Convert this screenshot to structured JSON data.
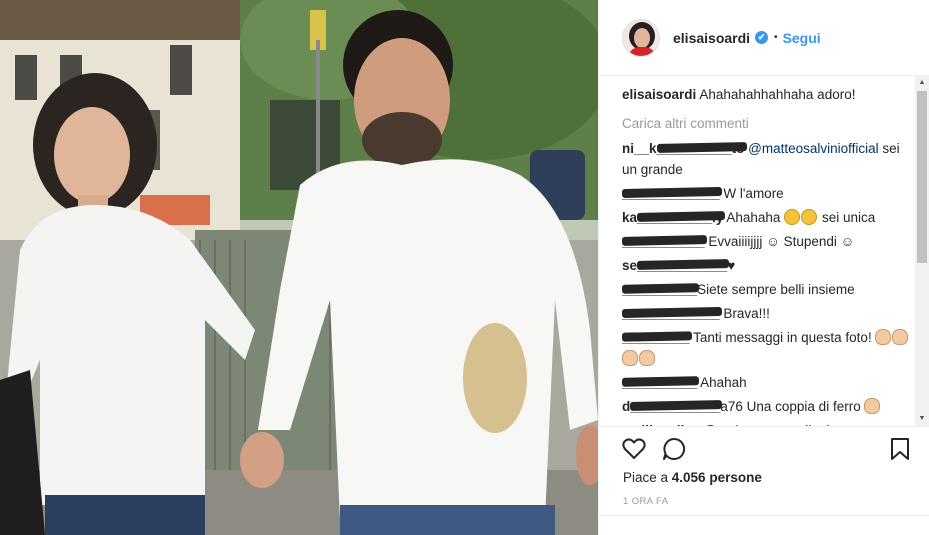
{
  "post": {
    "author": "elisaisoardi",
    "verified_mark": "✔",
    "separator": "•",
    "follow_label": "Segui"
  },
  "caption": {
    "author": "elisaisoardi",
    "text": "Ahahahahhahhaha adoro!"
  },
  "load_more_label": "Carica altri commenti",
  "comments": [
    {
      "user_visible": "ni__k",
      "user_hidden": "__________to",
      "mention": "@matteosalviniofficial",
      "text": " sei un grande"
    },
    {
      "user_visible": "",
      "user_hidden": "_____________",
      "mention": "",
      "text": " W l'amore"
    },
    {
      "user_visible": "ka",
      "user_hidden": "__________ly",
      "mention": "",
      "text": " Ahahaha ",
      "emojis": [
        "grinning-sweat-face",
        "grinning-sweat-face"
      ],
      "text_after": " sei unica"
    },
    {
      "user_visible": "",
      "user_hidden": "___________",
      "mention": "",
      "text": " Evvaiiiijjjj ☺ Stupendi ☺"
    },
    {
      "user_visible": "se",
      "user_hidden": "____________",
      "mention": "",
      "text": "♥"
    },
    {
      "user_visible": "",
      "user_hidden": "__________",
      "mention": "",
      "text": "Siete sempre belli insieme"
    },
    {
      "user_visible": "",
      "user_hidden": "_____________",
      "mention": "",
      "text": " Brava!!!"
    },
    {
      "user_visible": "",
      "user_hidden": "_________",
      "mention": "",
      "text": " Tanti messaggi in questa foto! ",
      "emojis": [
        "thumbs-up",
        "clapping-hands",
        "clapping-hands",
        "clapping-hands"
      ]
    },
    {
      "user_visible": "",
      "user_hidden": "__________",
      "mention": "",
      "text": " Ahahah"
    },
    {
      "user_visible": "d",
      "user_hidden": "____________",
      "mention": "",
      "text": "a76 Una coppia di ferro ",
      "emojis": [
        "clapping-hands"
      ]
    },
    {
      "user_visible": "smilingalice",
      "user_hidden": "",
      "mention": "@corinna.panza",
      "text": " il mio pure"
    }
  ],
  "actions": {
    "like_icon": "heart-outline-icon",
    "comment_icon": "speech-bubble-icon",
    "save_icon": "bookmark-icon",
    "likes_prefix": "Piace a ",
    "likes_count": "4.056",
    "likes_suffix": " persone",
    "timestamp": "1 ORA FA"
  },
  "colors": {
    "link": "#3897f0",
    "text": "#262626",
    "muted": "#999999",
    "mention": "#003569"
  }
}
